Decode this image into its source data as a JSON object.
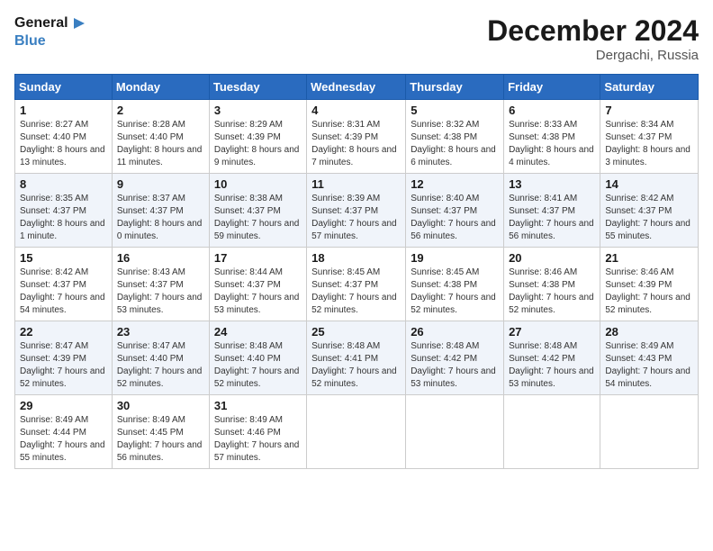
{
  "header": {
    "logo_line1": "General",
    "logo_line2": "Blue",
    "month": "December 2024",
    "location": "Dergachi, Russia"
  },
  "weekdays": [
    "Sunday",
    "Monday",
    "Tuesday",
    "Wednesday",
    "Thursday",
    "Friday",
    "Saturday"
  ],
  "weeks": [
    [
      {
        "day": "1",
        "sunrise": "8:27 AM",
        "sunset": "4:40 PM",
        "daylight": "8 hours and 13 minutes."
      },
      {
        "day": "2",
        "sunrise": "8:28 AM",
        "sunset": "4:40 PM",
        "daylight": "8 hours and 11 minutes."
      },
      {
        "day": "3",
        "sunrise": "8:29 AM",
        "sunset": "4:39 PM",
        "daylight": "8 hours and 9 minutes."
      },
      {
        "day": "4",
        "sunrise": "8:31 AM",
        "sunset": "4:39 PM",
        "daylight": "8 hours and 7 minutes."
      },
      {
        "day": "5",
        "sunrise": "8:32 AM",
        "sunset": "4:38 PM",
        "daylight": "8 hours and 6 minutes."
      },
      {
        "day": "6",
        "sunrise": "8:33 AM",
        "sunset": "4:38 PM",
        "daylight": "8 hours and 4 minutes."
      },
      {
        "day": "7",
        "sunrise": "8:34 AM",
        "sunset": "4:37 PM",
        "daylight": "8 hours and 3 minutes."
      }
    ],
    [
      {
        "day": "8",
        "sunrise": "8:35 AM",
        "sunset": "4:37 PM",
        "daylight": "8 hours and 1 minute."
      },
      {
        "day": "9",
        "sunrise": "8:37 AM",
        "sunset": "4:37 PM",
        "daylight": "8 hours and 0 minutes."
      },
      {
        "day": "10",
        "sunrise": "8:38 AM",
        "sunset": "4:37 PM",
        "daylight": "7 hours and 59 minutes."
      },
      {
        "day": "11",
        "sunrise": "8:39 AM",
        "sunset": "4:37 PM",
        "daylight": "7 hours and 57 minutes."
      },
      {
        "day": "12",
        "sunrise": "8:40 AM",
        "sunset": "4:37 PM",
        "daylight": "7 hours and 56 minutes."
      },
      {
        "day": "13",
        "sunrise": "8:41 AM",
        "sunset": "4:37 PM",
        "daylight": "7 hours and 56 minutes."
      },
      {
        "day": "14",
        "sunrise": "8:42 AM",
        "sunset": "4:37 PM",
        "daylight": "7 hours and 55 minutes."
      }
    ],
    [
      {
        "day": "15",
        "sunrise": "8:42 AM",
        "sunset": "4:37 PM",
        "daylight": "7 hours and 54 minutes."
      },
      {
        "day": "16",
        "sunrise": "8:43 AM",
        "sunset": "4:37 PM",
        "daylight": "7 hours and 53 minutes."
      },
      {
        "day": "17",
        "sunrise": "8:44 AM",
        "sunset": "4:37 PM",
        "daylight": "7 hours and 53 minutes."
      },
      {
        "day": "18",
        "sunrise": "8:45 AM",
        "sunset": "4:37 PM",
        "daylight": "7 hours and 52 minutes."
      },
      {
        "day": "19",
        "sunrise": "8:45 AM",
        "sunset": "4:38 PM",
        "daylight": "7 hours and 52 minutes."
      },
      {
        "day": "20",
        "sunrise": "8:46 AM",
        "sunset": "4:38 PM",
        "daylight": "7 hours and 52 minutes."
      },
      {
        "day": "21",
        "sunrise": "8:46 AM",
        "sunset": "4:39 PM",
        "daylight": "7 hours and 52 minutes."
      }
    ],
    [
      {
        "day": "22",
        "sunrise": "8:47 AM",
        "sunset": "4:39 PM",
        "daylight": "7 hours and 52 minutes."
      },
      {
        "day": "23",
        "sunrise": "8:47 AM",
        "sunset": "4:40 PM",
        "daylight": "7 hours and 52 minutes."
      },
      {
        "day": "24",
        "sunrise": "8:48 AM",
        "sunset": "4:40 PM",
        "daylight": "7 hours and 52 minutes."
      },
      {
        "day": "25",
        "sunrise": "8:48 AM",
        "sunset": "4:41 PM",
        "daylight": "7 hours and 52 minutes."
      },
      {
        "day": "26",
        "sunrise": "8:48 AM",
        "sunset": "4:42 PM",
        "daylight": "7 hours and 53 minutes."
      },
      {
        "day": "27",
        "sunrise": "8:48 AM",
        "sunset": "4:42 PM",
        "daylight": "7 hours and 53 minutes."
      },
      {
        "day": "28",
        "sunrise": "8:49 AM",
        "sunset": "4:43 PM",
        "daylight": "7 hours and 54 minutes."
      }
    ],
    [
      {
        "day": "29",
        "sunrise": "8:49 AM",
        "sunset": "4:44 PM",
        "daylight": "7 hours and 55 minutes."
      },
      {
        "day": "30",
        "sunrise": "8:49 AM",
        "sunset": "4:45 PM",
        "daylight": "7 hours and 56 minutes."
      },
      {
        "day": "31",
        "sunrise": "8:49 AM",
        "sunset": "4:46 PM",
        "daylight": "7 hours and 57 minutes."
      },
      null,
      null,
      null,
      null
    ]
  ]
}
